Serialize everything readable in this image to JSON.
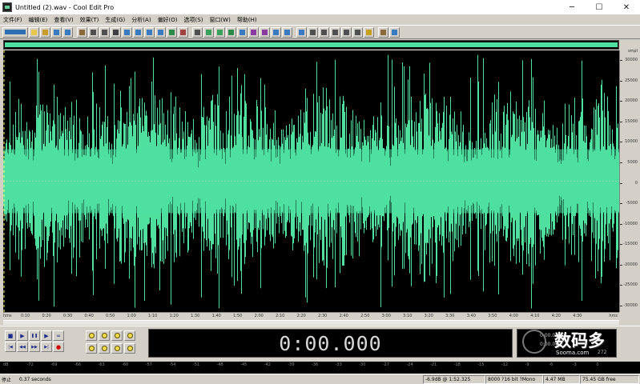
{
  "window": {
    "title": "Untitled (2).wav - Cool Edit Pro",
    "minimize": "─",
    "maximize": "☐",
    "close": "✕"
  },
  "menu": [
    "文件(F)",
    "编辑(E)",
    "查看(V)",
    "效果(T)",
    "生成(G)",
    "分析(A)",
    "偏好(O)",
    "选项(S)",
    "窗口(W)",
    "帮助(H)"
  ],
  "toolbar": {
    "buttons": [
      "switch-view-icon",
      "new-icon",
      "open-icon",
      "save-icon",
      "save-as-icon",
      "close-file-icon",
      "undo-icon",
      "redo-icon",
      "cut-icon",
      "copy-icon",
      "paste-icon",
      "paste-new-icon",
      "mix-paste-icon",
      "trim-icon",
      "delete-icon",
      "silence-icon",
      "amplify-icon",
      "normalize-icon",
      "envelope-icon",
      "fade-icon",
      "echo-icon",
      "reverb-icon",
      "noise-icon",
      "spectrum-icon",
      "frequency-icon",
      "cue-list-icon",
      "play-list-icon",
      "info-icon",
      "properties-icon",
      "settings-icon",
      "favorite-icon",
      "script-icon",
      "help-icon"
    ]
  },
  "waveform": {
    "color": "#4fe0a0",
    "background": "#000000",
    "amplitude_scale": [
      "smpl",
      "30000",
      "25000",
      "20000",
      "15000",
      "10000",
      "5000",
      "0",
      "-5000",
      "-10000",
      "-15000",
      "-20000",
      "-25000",
      "-30000"
    ]
  },
  "ruler": {
    "unit": "hms",
    "ticks": [
      "0:10",
      "0:20",
      "0:30",
      "0:40",
      "0:50",
      "1:00",
      "1:10",
      "1:20",
      "1:30",
      "1:40",
      "1:50",
      "2:00",
      "2:10",
      "2:20",
      "2:30",
      "2:40",
      "2:50",
      "3:00",
      "3:10",
      "3:20",
      "3:30",
      "3:40",
      "3:50",
      "4:00",
      "4:10",
      "4:20",
      "4:30"
    ],
    "end_unit": "hms"
  },
  "transport": {
    "buttons_row1": [
      "stop-icon",
      "play-icon",
      "pause-icon",
      "play-from-cursor-icon",
      "loop-icon"
    ],
    "buttons_row2": [
      "go-to-start-icon",
      "rewind-icon",
      "fast-forward-icon",
      "go-to-end-icon",
      "record-icon"
    ],
    "glyphs_row1": [
      "■",
      "▶",
      "❚❚",
      "▶",
      "∞"
    ],
    "glyphs_row2": [
      "|◀",
      "◀◀",
      "▶▶",
      "▶|",
      "●"
    ],
    "zoom_buttons": [
      "zoom-in-horizontal-icon",
      "zoom-out-horizontal-icon",
      "zoom-full-icon",
      "zoom-selection-icon",
      "zoom-in-left-icon",
      "zoom-out-right-icon",
      "zoom-in-vertical-icon",
      "zoom-out-vertical-icon"
    ]
  },
  "time_display": "0:00.000",
  "info": {
    "row1": "0:00.000",
    "row2": "0:00.000",
    "row3": "272",
    "side": "272"
  },
  "watermark": {
    "text": "数码多",
    "sub": "Sooma.com"
  },
  "meter_labels": [
    "dB",
    "-72",
    "-69",
    "-66",
    "-63",
    "-60",
    "-57",
    "-54",
    "-51",
    "-48",
    "-45",
    "-42",
    "-39",
    "-36",
    "-33",
    "-30",
    "-27",
    "-24",
    "-21",
    "-18",
    "-15",
    "-12",
    "-9",
    "-6",
    "-3",
    "0"
  ],
  "status": {
    "state": "停止",
    "duration": "0.37 seconds",
    "level": "-6.9dB @ 1:52.325",
    "format": "8000 ?16 bit ?Mono",
    "size": "4.47 MB",
    "free": "75.45 GB free"
  }
}
